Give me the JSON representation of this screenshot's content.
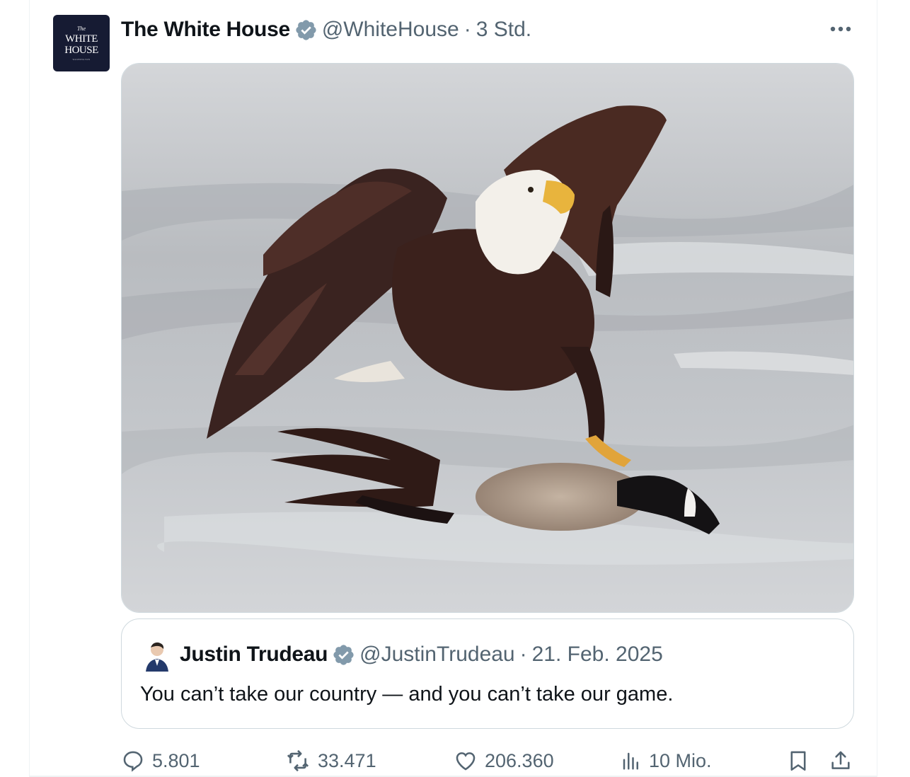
{
  "tweet": {
    "author_name": "The White House",
    "author_handle": "@WhiteHouse",
    "separator": "·",
    "time": "3 Std.",
    "avatar": {
      "line1": "The",
      "line2": "WHITE",
      "line3": "HOUSE",
      "line4": "WASHINGTON"
    },
    "verified_color": "#829aab",
    "media_alt": "Photo: bald eagle pinning a Canada goose on ice"
  },
  "quoted_tweet": {
    "author_name": "Justin Trudeau",
    "author_handle": "@JustinTrudeau",
    "separator": "·",
    "date": "21. Feb. 2025",
    "text": "You can’t take our country — and you can’t take our game."
  },
  "actions": {
    "replies": "5.801",
    "reposts": "33.471",
    "likes": "206.360",
    "views": "10 Mio."
  },
  "colors": {
    "text_primary": "#0f1419",
    "text_secondary": "#536471",
    "border": "#cfd9de"
  }
}
